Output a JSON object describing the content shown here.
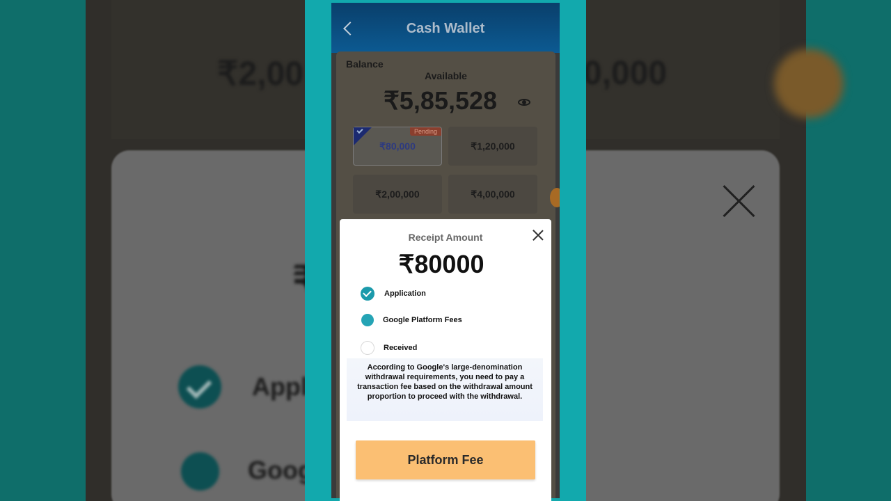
{
  "background": {
    "left_amount": "₹2,00",
    "right_amount": "0,000",
    "rupee_glyph": "₹",
    "appl_text": "Appl",
    "goog_text": "Goog"
  },
  "header": {
    "title": "Cash Wallet",
    "back_icon": "chevron-left-icon"
  },
  "balance": {
    "label": "Balance",
    "available_label": "Available",
    "amount": "₹5,85,528",
    "visibility_icon": "eye-icon"
  },
  "withdraw_options": [
    {
      "label": "₹80,000",
      "selected": true,
      "badge": "Pending"
    },
    {
      "label": "₹1,20,000",
      "selected": false
    },
    {
      "label": "₹2,00,000",
      "selected": false
    },
    {
      "label": "₹4,00,000",
      "selected": false
    }
  ],
  "dialog": {
    "title": "Receipt Amount",
    "amount": "₹80000",
    "steps": [
      {
        "label": "Application",
        "state": "done"
      },
      {
        "label": "Google Platform Fees",
        "state": "current"
      },
      {
        "label": "Received",
        "state": "pending"
      }
    ],
    "notice": "According to Google's large-denomination withdrawal requirements, you need to pay a transaction fee based on the withdrawal amount proportion to proceed with the withdrawal.",
    "button_label": "Platform Fee"
  },
  "colors": {
    "frame": "#12a9ad",
    "header": "#0c5a92",
    "accent": "#1b9aab",
    "button": "#fbbf73"
  }
}
